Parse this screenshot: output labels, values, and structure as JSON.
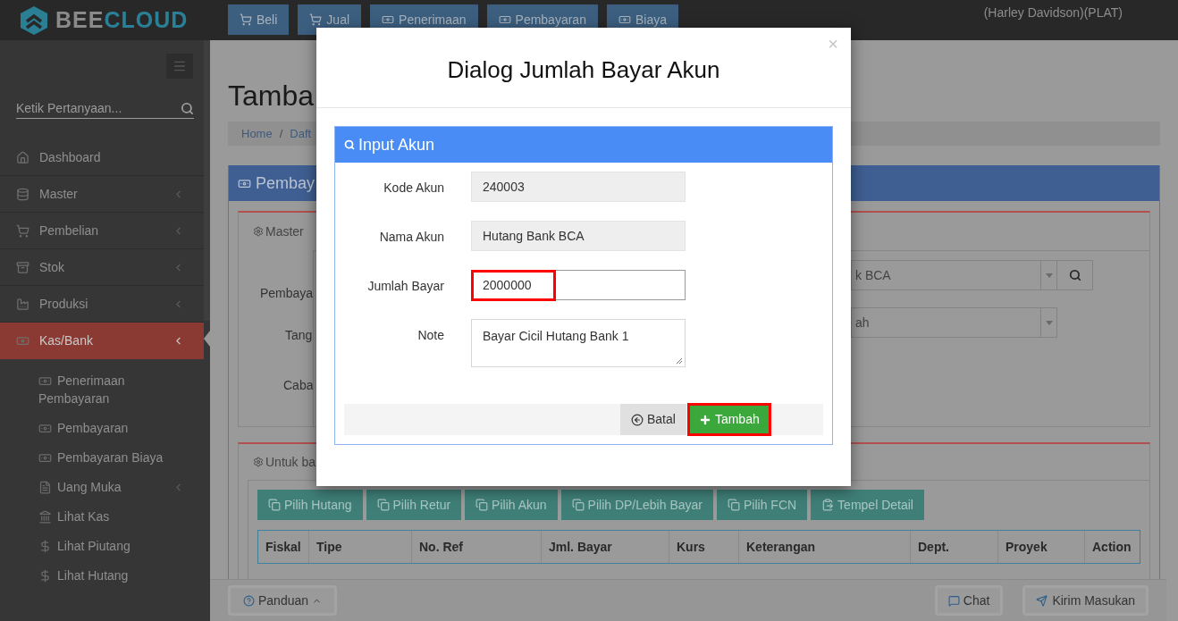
{
  "topbar": {
    "logo": {
      "first": "BEE",
      "second": "CLOUD"
    },
    "nav": [
      {
        "label": "Beli"
      },
      {
        "label": "Jual"
      },
      {
        "label": "Penerimaan"
      },
      {
        "label": "Pembayaran"
      },
      {
        "label": "Biaya"
      }
    ],
    "user": "(Harley Davidson)(PLAT)"
  },
  "sidebar": {
    "search": {
      "placeholder": "Ketik Pertanyaan..."
    },
    "items": [
      {
        "label": "Dashboard",
        "has_submenu": false,
        "selected": false
      },
      {
        "label": "Master",
        "has_submenu": true,
        "selected": false
      },
      {
        "label": "Pembelian",
        "has_submenu": true,
        "selected": false
      },
      {
        "label": "Stok",
        "has_submenu": true,
        "selected": false
      },
      {
        "label": "Produksi",
        "has_submenu": true,
        "selected": false
      },
      {
        "label": "Kas/Bank",
        "has_submenu": true,
        "selected": true,
        "children": [
          {
            "label": "Penerimaan Pembayaran",
            "has_submenu": false,
            "selected": false
          },
          {
            "label": "Pembayaran",
            "has_submenu": false,
            "selected": false
          },
          {
            "label": "Pembayaran Biaya",
            "has_submenu": false,
            "selected": false
          },
          {
            "label": "Uang Muka",
            "has_submenu": true,
            "selected": false
          },
          {
            "label": "Lihat Kas",
            "has_submenu": false,
            "selected": false
          },
          {
            "label": "Lihat Piutang",
            "has_submenu": false,
            "selected": false
          },
          {
            "label": "Lihat Hutang",
            "has_submenu": false,
            "selected": false
          }
        ]
      }
    ]
  },
  "page": {
    "title": "Tamba",
    "breadcrumb": [
      "Home",
      "Daft"
    ],
    "breadcrumb_separator": "/",
    "panel_title": "Pembay",
    "master": {
      "tab": "Master",
      "labels": [
        "Pembaya",
        "Tang",
        "Caba"
      ],
      "selects": [
        "k BCA",
        "ah"
      ]
    },
    "detail": {
      "tab": "Untuk ba",
      "buttons": [
        {
          "label": "Pilih Hutang"
        },
        {
          "label": "Pilih Retur"
        },
        {
          "label": "Pilih Akun"
        },
        {
          "label": "Pilih DP/Lebih Bayar"
        },
        {
          "label": "Pilih FCN"
        },
        {
          "label": "Tempel Detail"
        }
      ],
      "table": {
        "columns": [
          "Fiskal",
          "Tipe",
          "No. Ref",
          "Jml. Bayar",
          "Kurs",
          "Keterangan",
          "Dept.",
          "Proyek",
          "Action"
        ]
      }
    }
  },
  "footer": {
    "guide": "Panduan",
    "chat": "Chat",
    "feedback": "Kirim Masukan"
  },
  "dialog": {
    "title": "Dialog Jumlah Bayar Akun",
    "close": "×",
    "panel_title": "Input Akun",
    "fields": [
      {
        "label": "Kode Akun",
        "kind": "readonly",
        "value": "240003",
        "highlighted": false
      },
      {
        "label": "Nama Akun",
        "kind": "readonly",
        "value": "Hutang Bank BCA",
        "highlighted": false
      },
      {
        "label": "Jumlah Bayar",
        "kind": "input",
        "value": "2000000",
        "highlighted": true
      },
      {
        "label": "Note",
        "kind": "textarea",
        "value": "Bayar Cicil Hutang Bank 1",
        "highlighted": false
      }
    ],
    "buttons": [
      {
        "label": "Batal",
        "kind": "cancel",
        "highlighted": false
      },
      {
        "label": "Tambah",
        "kind": "primary",
        "highlighted": true
      }
    ]
  }
}
